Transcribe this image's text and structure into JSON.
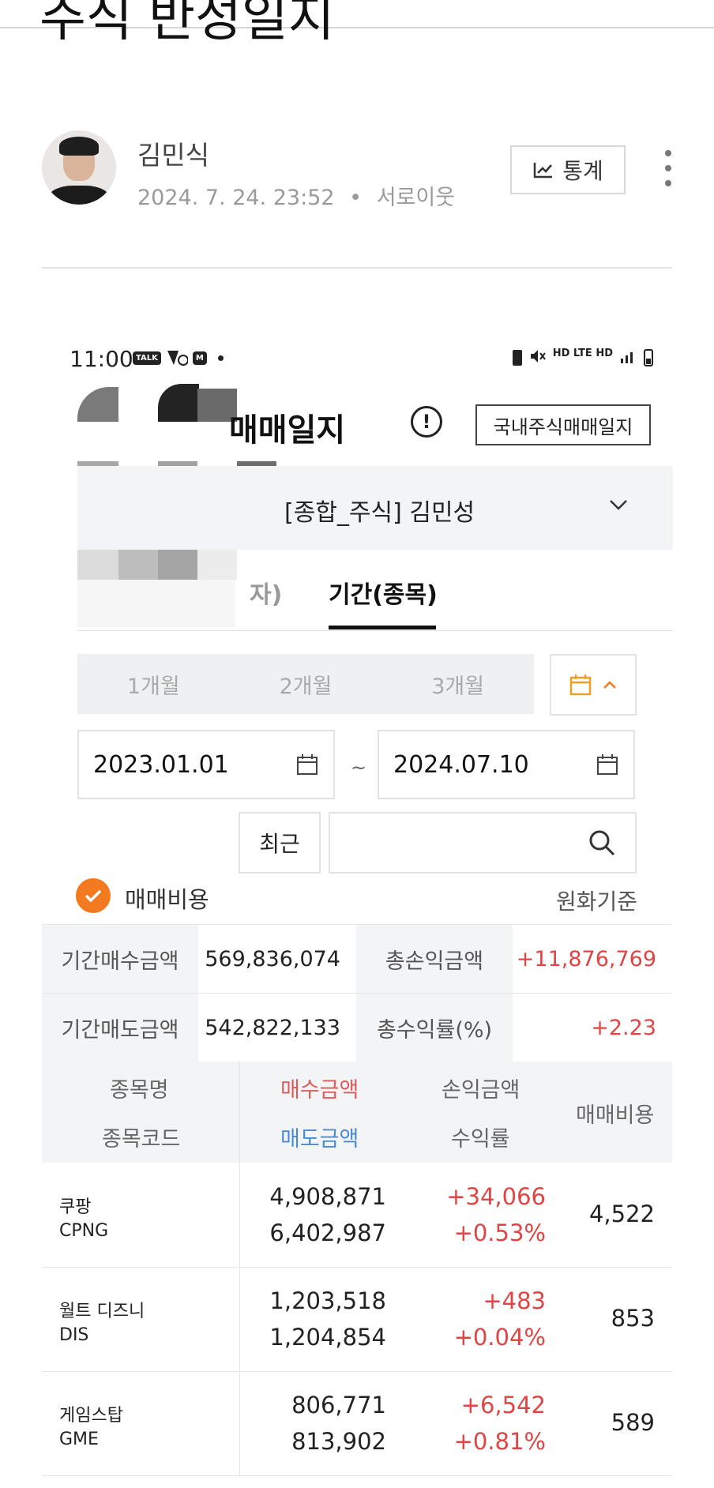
{
  "post": {
    "title": "주식 반성일지",
    "author": "김민식",
    "date": "2024. 7. 24. 23:52",
    "separator": "•",
    "relation": "서로이웃",
    "stats_label": "통계"
  },
  "phone": {
    "time": "11:00",
    "status_chips": [
      "TALK",
      "M"
    ],
    "status_right": "HD LTE HD"
  },
  "app": {
    "title": "매매일지",
    "domestic_button": "국내주식매매일지",
    "account": "[종합_주식] 김민성",
    "tabs": [
      {
        "label": "자)",
        "active": false
      },
      {
        "label": "기간(종목)",
        "active": true
      }
    ],
    "periods": [
      "1개월",
      "2개월",
      "3개월"
    ],
    "date_from": "2023.01.01",
    "date_sep": "~",
    "date_to": "2024.07.10",
    "recent_button": "최근",
    "search_placeholder": "",
    "fee_checkbox": "매매비용",
    "currency_basis": "원화기준",
    "accent_color": "#f47a20"
  },
  "summary": {
    "rows": [
      {
        "k1": "기간매수금액",
        "v1": "569,836,074",
        "k2": "총손익금액",
        "v2": "+11,876,769"
      },
      {
        "k1": "기간매도금액",
        "v1": "542,822,133",
        "k2": "총수익률(%)",
        "v2": "+2.23"
      }
    ]
  },
  "table": {
    "headers": {
      "name": "종목명",
      "code": "종목코드",
      "buy": "매수금액",
      "sell": "매도금액",
      "pl": "손익금액",
      "rate": "수익률",
      "fee": "매매비용"
    },
    "rows": [
      {
        "name": "쿠팡",
        "code": "CPNG",
        "buy": "4,908,871",
        "sell": "6,402,987",
        "pl": "+34,066",
        "rate": "+0.53%",
        "fee": "4,522"
      },
      {
        "name": "월트 디즈니",
        "code": "DIS",
        "buy": "1,203,518",
        "sell": "1,204,854",
        "pl": "+483",
        "rate": "+0.04%",
        "fee": "853"
      },
      {
        "name": "게임스탑",
        "code": "GME",
        "buy": "806,771",
        "sell": "813,902",
        "pl": "+6,542",
        "rate": "+0.81%",
        "fee": "589"
      }
    ]
  }
}
